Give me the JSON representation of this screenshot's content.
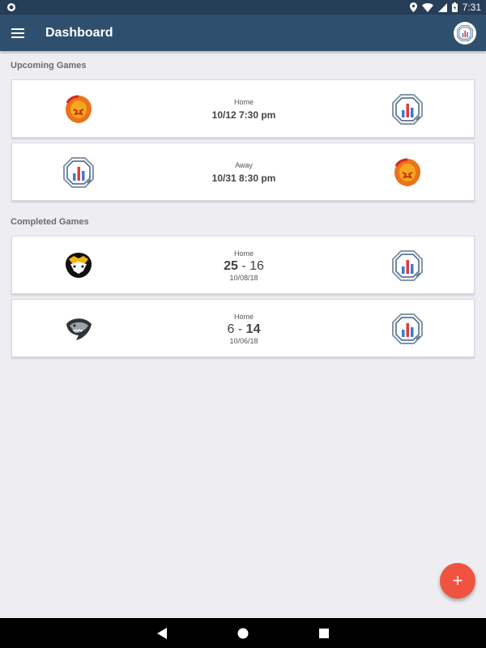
{
  "status_bar": {
    "time": "7:31",
    "icons": [
      "location-icon",
      "wifi-icon",
      "signal-icon",
      "battery-icon"
    ]
  },
  "app_bar": {
    "title": "Dashboard",
    "menu_icon": "menu-icon",
    "profile_icon": "team-logo-icon"
  },
  "upcoming": {
    "header": "Upcoming Games",
    "games": [
      {
        "venue": "Home",
        "when": "10/12 7:30 pm",
        "left_logo": "lion-logo",
        "right_logo": "bars-logo"
      },
      {
        "venue": "Away",
        "when": "10/31 8:30 pm",
        "left_logo": "bars-logo",
        "right_logo": "lion-logo"
      }
    ]
  },
  "completed": {
    "header": "Completed Games",
    "games": [
      {
        "venue": "Home",
        "score_left": "25",
        "separator": "-",
        "score_right": "16",
        "date": "10/08/18",
        "left_logo": "badger-logo",
        "right_logo": "bars-logo"
      },
      {
        "venue": "Home",
        "score_left": "6",
        "separator": "-",
        "score_right": "14",
        "date": "10/06/18",
        "left_logo": "shark-logo",
        "right_logo": "bars-logo"
      }
    ]
  },
  "fab": {
    "label": "+"
  },
  "colors": {
    "app_bar": "#2f4f6e",
    "status_bar": "#263e57",
    "fab": "#f0533f",
    "background": "#eeeef2"
  }
}
